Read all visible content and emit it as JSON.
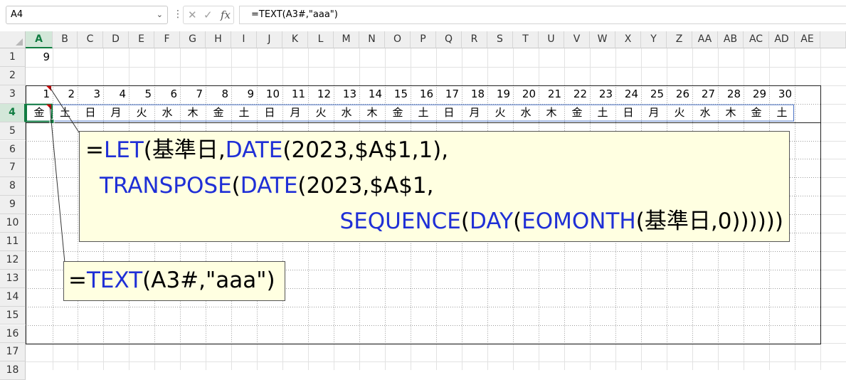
{
  "formula_bar": {
    "name_box": "A4",
    "formula": "=TEXT(A3#,\"aaa\")",
    "icons": [
      "cancel-icon",
      "enter-icon",
      "function-icon"
    ]
  },
  "sheet": {
    "columns": [
      "A",
      "B",
      "C",
      "D",
      "E",
      "F",
      "G",
      "H",
      "I",
      "J",
      "K",
      "L",
      "M",
      "N",
      "O",
      "P",
      "Q",
      "R",
      "S",
      "T",
      "U",
      "V",
      "W",
      "X",
      "Y",
      "Z",
      "AA",
      "AB",
      "AC",
      "AD",
      "AE"
    ],
    "rows": [
      "1",
      "2",
      "3",
      "4",
      "5",
      "6",
      "7",
      "8",
      "9",
      "10",
      "11",
      "12",
      "13",
      "14",
      "15",
      "16",
      "17",
      "18"
    ],
    "selected_column": "A",
    "selected_row": "4",
    "a1_value": "9",
    "row3_days": [
      "1",
      "2",
      "3",
      "4",
      "5",
      "6",
      "7",
      "8",
      "9",
      "10",
      "11",
      "12",
      "13",
      "14",
      "15",
      "16",
      "17",
      "18",
      "19",
      "20",
      "21",
      "22",
      "23",
      "24",
      "25",
      "26",
      "27",
      "28",
      "29",
      "30"
    ],
    "row4_weekdays": [
      "金",
      "土",
      "日",
      "月",
      "火",
      "水",
      "木",
      "金",
      "土",
      "日",
      "月",
      "火",
      "水",
      "木",
      "金",
      "土",
      "日",
      "月",
      "火",
      "水",
      "木",
      "金",
      "土",
      "日",
      "月",
      "火",
      "水",
      "木",
      "金",
      "土"
    ]
  },
  "callouts": {
    "big": {
      "line1": [
        {
          "t": "=",
          "fn": false
        },
        {
          "t": "LET",
          "fn": true
        },
        {
          "t": "(基準日,",
          "fn": false
        },
        {
          "t": "DATE",
          "fn": true
        },
        {
          "t": "(2023,$A$1,1),",
          "fn": false
        }
      ],
      "line2": [
        {
          "t": "TRANSPOSE",
          "fn": true
        },
        {
          "t": "(",
          "fn": false
        },
        {
          "t": "DATE",
          "fn": true
        },
        {
          "t": "(2023,$A$1,",
          "fn": false
        }
      ],
      "line3": [
        {
          "t": "SEQUENCE",
          "fn": true
        },
        {
          "t": "(",
          "fn": false
        },
        {
          "t": "DAY",
          "fn": true
        },
        {
          "t": "(",
          "fn": false
        },
        {
          "t": "EOMONTH",
          "fn": true
        },
        {
          "t": "(基準日,0))))))",
          "fn": false
        }
      ]
    },
    "small": {
      "line1": [
        {
          "t": "=",
          "fn": false
        },
        {
          "t": "TEXT",
          "fn": true
        },
        {
          "t": "(A3#,\"aaa\")",
          "fn": false
        }
      ]
    }
  },
  "colors": {
    "function_blue": "#1f2fd6",
    "excel_green": "#107c41",
    "callout_fill": "#ffffe1",
    "spill_border": "#4a72c4"
  }
}
